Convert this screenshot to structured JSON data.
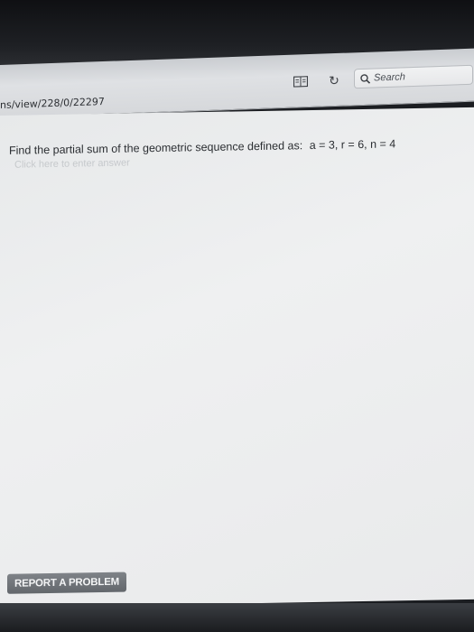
{
  "toolbar": {
    "url_fragment": "ns/view/228/0/22297",
    "search_placeholder": "Search",
    "reader_icon": "reader-icon",
    "reload_icon": "reload-icon",
    "search_icon": "search-icon"
  },
  "content": {
    "question_text": "Find the partial sum of the geometric sequence defined as:",
    "question_equation": "a = 3, r = 6, n = 4",
    "answer_placeholder": "Click here to enter answer"
  },
  "footer": {
    "report_label": "REPORT A PROBLEM"
  }
}
